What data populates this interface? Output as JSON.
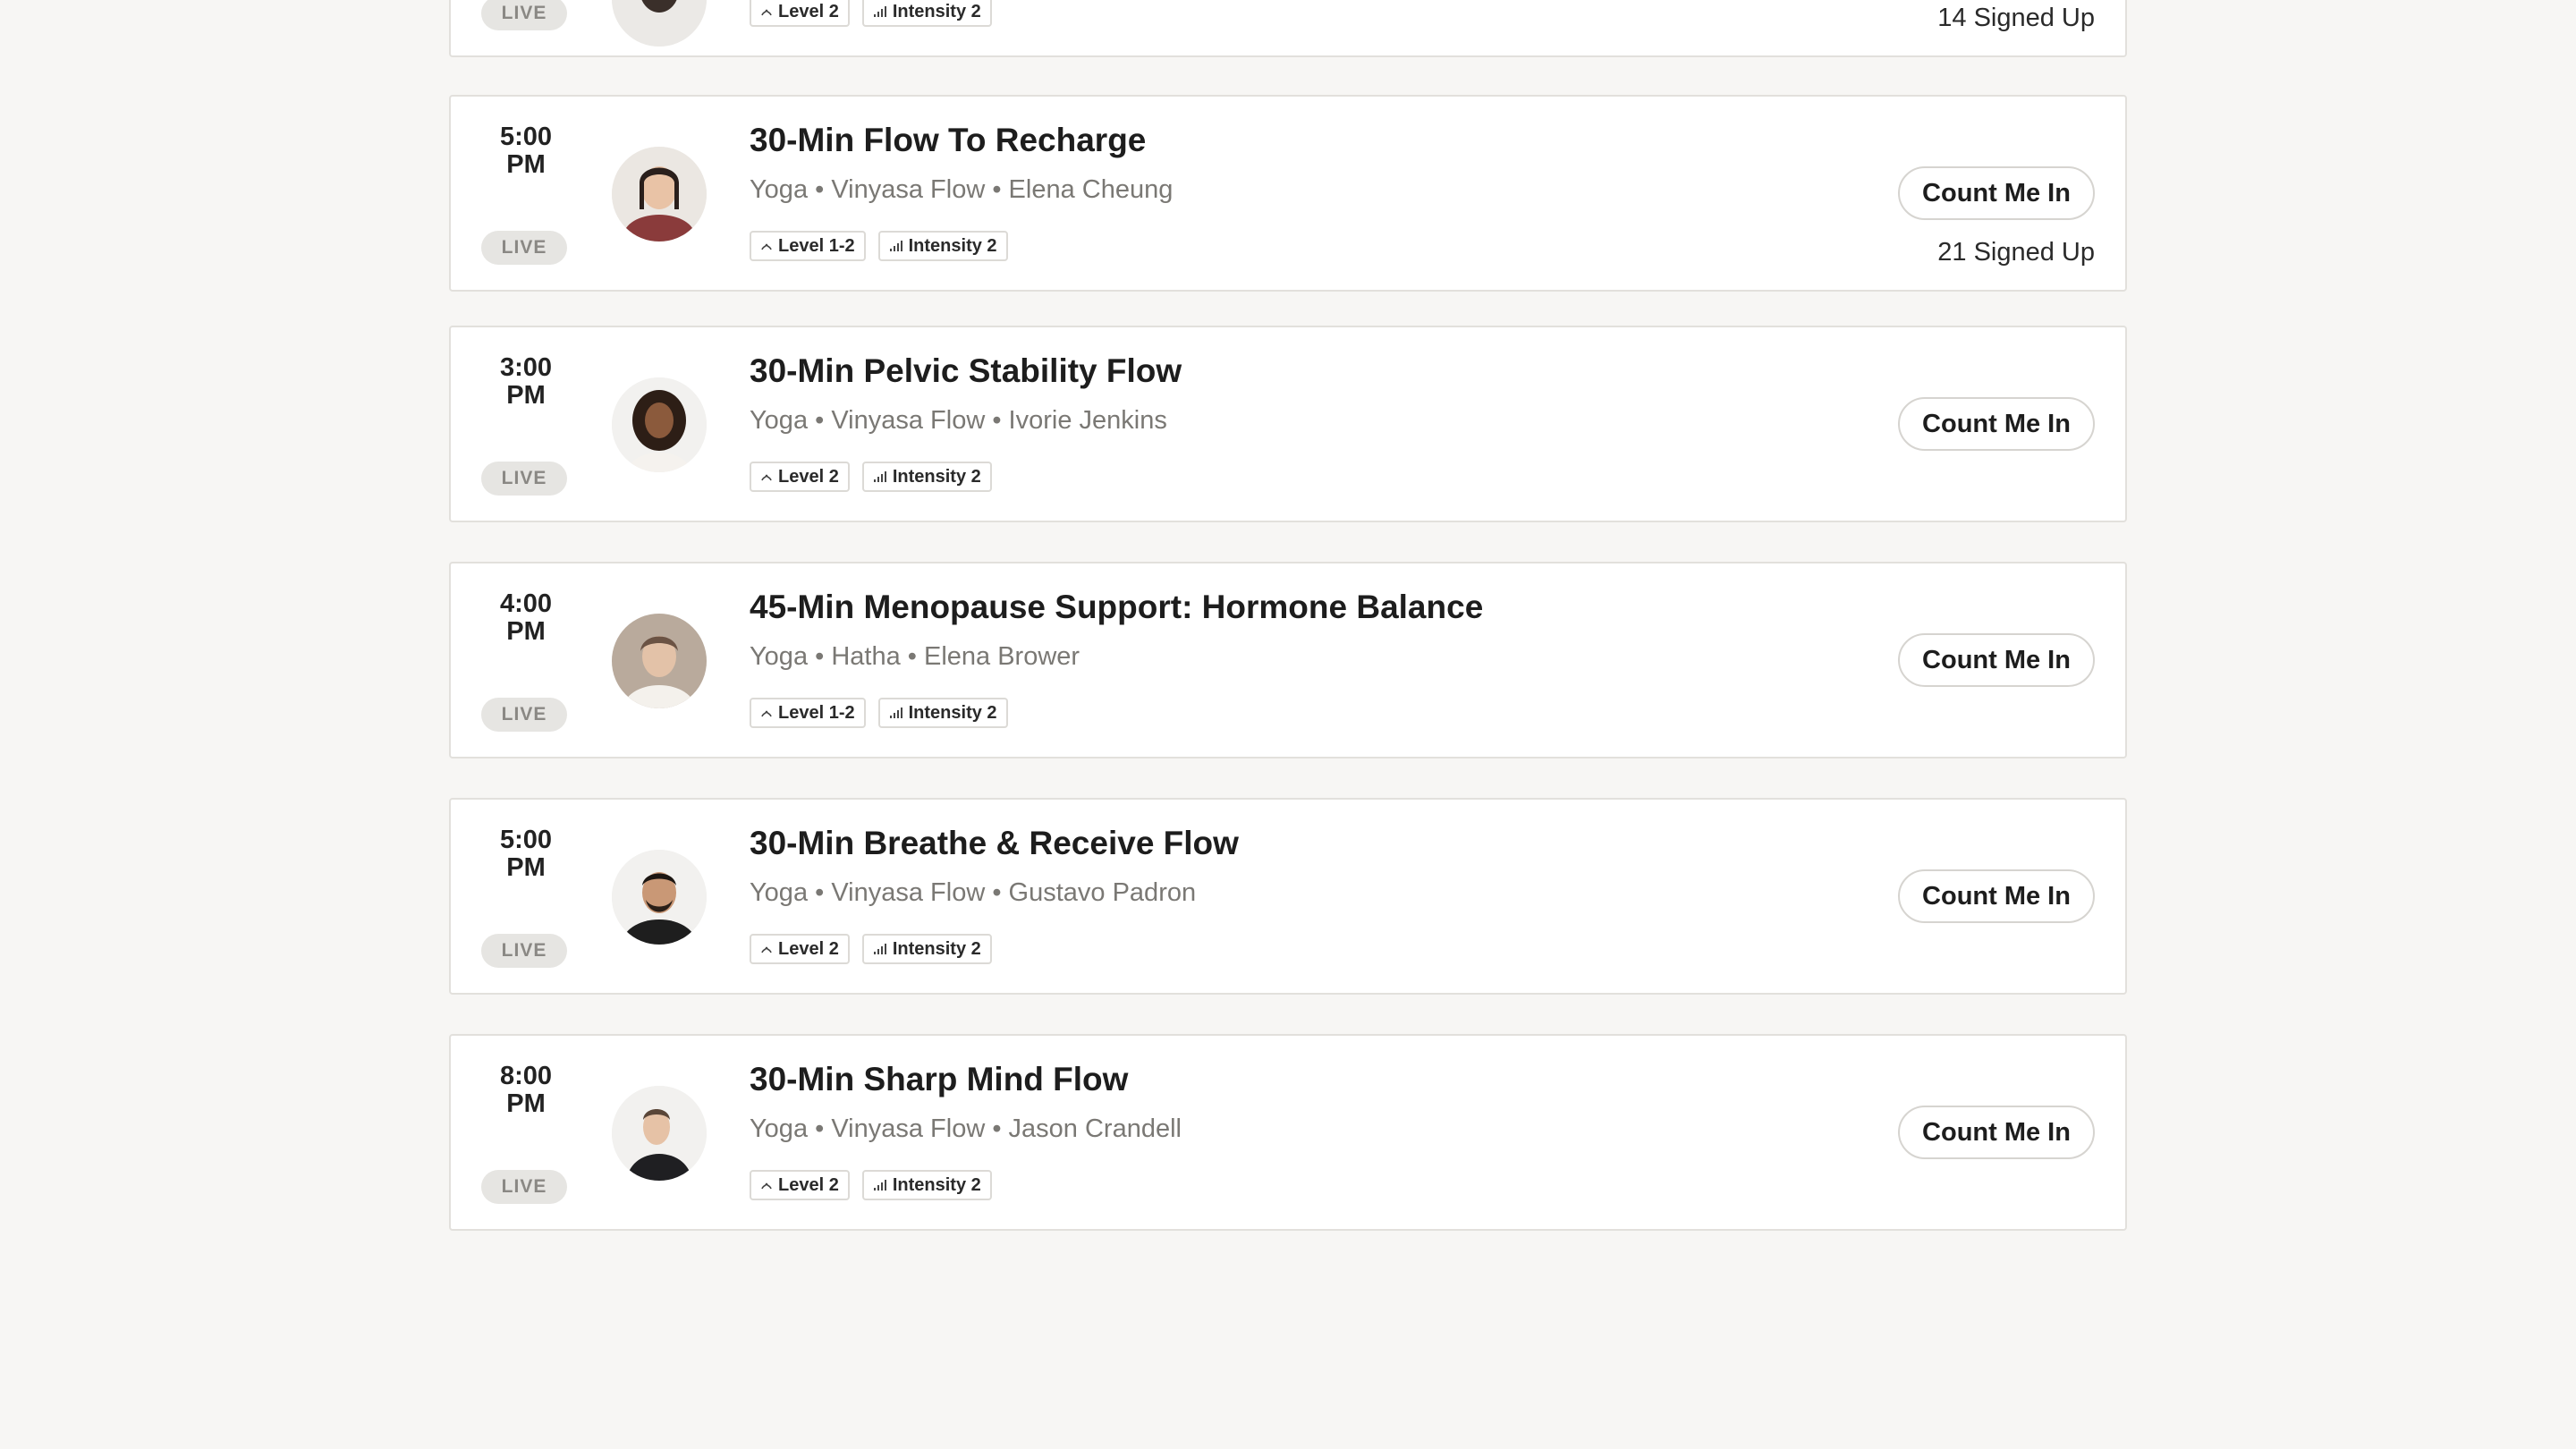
{
  "classes": [
    {
      "time_top": "",
      "time_bottom": "",
      "live": "LIVE",
      "title": "",
      "meta": "",
      "level": "Level 2",
      "intensity": "Intensity 2",
      "button": "",
      "signed_up": "14 Signed Up"
    },
    {
      "time_top": "5:00",
      "time_bottom": "PM",
      "live": "LIVE",
      "title": "30-Min Flow To Recharge",
      "meta": "Yoga • Vinyasa Flow • Elena Cheung",
      "level": "Level 1-2",
      "intensity": "Intensity 2",
      "button": "Count Me In",
      "signed_up": "21 Signed Up"
    },
    {
      "time_top": "3:00",
      "time_bottom": "PM",
      "live": "LIVE",
      "title": "30-Min Pelvic Stability Flow",
      "meta": "Yoga • Vinyasa Flow • Ivorie Jenkins",
      "level": "Level 2",
      "intensity": "Intensity 2",
      "button": "Count Me In",
      "signed_up": ""
    },
    {
      "time_top": "4:00",
      "time_bottom": "PM",
      "live": "LIVE",
      "title": "45-Min Menopause Support: Hormone Balance",
      "meta": "Yoga • Hatha • Elena Brower",
      "level": "Level 1-2",
      "intensity": "Intensity 2",
      "button": "Count Me In",
      "signed_up": ""
    },
    {
      "time_top": "5:00",
      "time_bottom": "PM",
      "live": "LIVE",
      "title": "30-Min Breathe & Receive Flow",
      "meta": "Yoga • Vinyasa Flow • Gustavo Padron",
      "level": "Level 2",
      "intensity": "Intensity 2",
      "button": "Count Me In",
      "signed_up": ""
    },
    {
      "time_top": "8:00",
      "time_bottom": "PM",
      "live": "LIVE",
      "title": "30-Min Sharp Mind Flow",
      "meta": "Yoga • Vinyasa Flow • Jason Crandell",
      "level": "Level 2",
      "intensity": "Intensity 2",
      "button": "Count Me In",
      "signed_up": ""
    }
  ],
  "icons": {
    "level": "level-icon",
    "intensity": "intensity-bars-icon",
    "avatar": "instructor-avatar"
  },
  "colors": {
    "background": "#f7f6f4",
    "card": "#ffffff",
    "live_pill": "#e6e5e2",
    "muted_text": "#7a7874"
  }
}
